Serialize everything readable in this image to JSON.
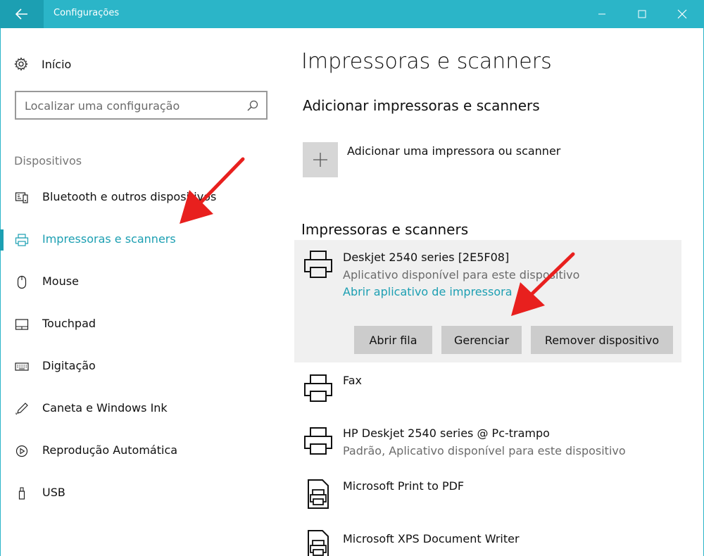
{
  "window": {
    "title": "Configurações"
  },
  "sidebar": {
    "home_label": "Início",
    "search_placeholder": "Localizar uma configuração",
    "section_label": "Dispositivos",
    "items": [
      {
        "label": "Bluetooth e outros dispositivos",
        "icon": "bluetooth-devices-icon",
        "active": false
      },
      {
        "label": "Impressoras e scanners",
        "icon": "printer-icon",
        "active": true
      },
      {
        "label": "Mouse",
        "icon": "mouse-icon",
        "active": false
      },
      {
        "label": "Touchpad",
        "icon": "touchpad-icon",
        "active": false
      },
      {
        "label": "Digitação",
        "icon": "keyboard-icon",
        "active": false
      },
      {
        "label": "Caneta e Windows Ink",
        "icon": "pen-icon",
        "active": false
      },
      {
        "label": "Reprodução Automática",
        "icon": "autoplay-icon",
        "active": false
      },
      {
        "label": "USB",
        "icon": "usb-icon",
        "active": false
      }
    ]
  },
  "main": {
    "page_title": "Impressoras e scanners",
    "add_section_title": "Adicionar impressoras e scanners",
    "add_label": "Adicionar uma impressora ou scanner",
    "list_title": "Impressoras e scanners",
    "selected_device": {
      "name": "Deskjet 2540 series [2E5F08]",
      "status": "Aplicativo disponível para este dispositivo",
      "link": "Abrir aplicativo de impressora",
      "buttons": [
        "Abrir fila",
        "Gerenciar",
        "Remover dispositivo"
      ]
    },
    "devices": [
      {
        "name": "Fax",
        "status": ""
      },
      {
        "name": "HP Deskjet 2540 series @ Pc-trampo",
        "status": "Padrão, Aplicativo disponível para este dispositivo"
      },
      {
        "name": "Microsoft Print to PDF",
        "status": ""
      },
      {
        "name": "Microsoft XPS Document Writer",
        "status": ""
      }
    ]
  },
  "colors": {
    "accent": "#2bb5c8",
    "accent_dark": "#1c9fb2",
    "annotation_arrow": "#e8201e"
  }
}
